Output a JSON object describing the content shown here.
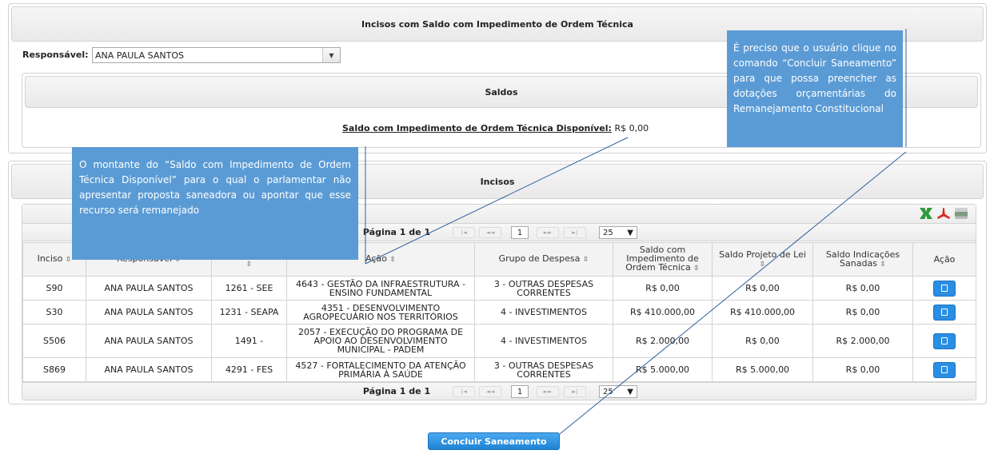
{
  "top_panel": {
    "title": "Incisos com Saldo com Impedimento de Ordem Técnica",
    "responsavel_label": "Responsável:",
    "responsavel_value": "ANA PAULA SANTOS"
  },
  "saldos": {
    "title": "Saldos",
    "label": "Saldo com Impedimento de Ordem Técnica Disponível:",
    "value": "R$ 0,00"
  },
  "incisos": {
    "title": "Incisos",
    "pager_text": "Página 1 de 1",
    "page_number": "1",
    "page_size": "25",
    "columns": [
      "Inciso",
      "Responsável",
      "",
      "Ação",
      "Grupo de Despesa",
      "Saldo com Impedimento de Ordem Técnica",
      "Saldo Projeto de Lei",
      "Saldo Indicações Sanadas",
      "Ação"
    ],
    "rows": [
      {
        "inciso": "S90",
        "responsavel": "ANA PAULA SANTOS",
        "orgao": "1261 - SEE",
        "acao": "4643 - GESTÃO DA INFRAESTRUTURA - ENSINO FUNDAMENTAL",
        "grupo": "3 - OUTRAS DESPESAS CORRENTES",
        "saldo_impedimento": "R$ 0,00",
        "saldo_projeto": "R$ 0,00",
        "saldo_sanadas": "R$ 0,00"
      },
      {
        "inciso": "S30",
        "responsavel": "ANA PAULA SANTOS",
        "orgao": "1231 - SEAPA",
        "acao": "4351 - DESENVOLVIMENTO AGROPECUÁRIO NOS TERRITÓRIOS",
        "grupo": "4 - INVESTIMENTOS",
        "saldo_impedimento": "R$ 410.000,00",
        "saldo_projeto": "R$ 410.000,00",
        "saldo_sanadas": "R$ 0,00"
      },
      {
        "inciso": "S506",
        "responsavel": "ANA PAULA SANTOS",
        "orgao": "1491 -",
        "acao": "2057 - EXECUÇÃO DO PROGRAMA DE APOIO AO DESENVOLVIMENTO MUNICIPAL - PADEM",
        "grupo": "4 - INVESTIMENTOS",
        "saldo_impedimento": "R$ 2.000,00",
        "saldo_projeto": "R$ 0,00",
        "saldo_sanadas": "R$ 2.000,00"
      },
      {
        "inciso": "S869",
        "responsavel": "ANA PAULA SANTOS",
        "orgao": "4291 - FES",
        "acao": "4527 - FORTALECIMENTO DA ATENÇÃO PRIMÁRIA À SAÚDE",
        "grupo": "3 - OUTRAS DESPESAS CORRENTES",
        "saldo_impedimento": "R$ 5.000,00",
        "saldo_projeto": "R$ 5.000,00",
        "saldo_sanadas": "R$ 0,00"
      }
    ]
  },
  "concluir_button": "Concluir Saneamento",
  "callouts": {
    "left": "O montante do “Saldo com Impedimento de Ordem Técnica Disponível” para o qual o parlamentar não apresentar proposta saneadora ou apontar que esse recurso será remanejado",
    "right": "É preciso que o usuário clique no comando “Concluir Saneamento” para que possa preencher as dotações orçamentárias do Remanejamento Constitucional"
  },
  "colors": {
    "callout": "#5b9bd5",
    "button": "#1d83d6",
    "line": "#2f5f9e"
  },
  "icons": [
    "excel-export-icon",
    "pdf-export-icon",
    "print-icon",
    "sort-icon",
    "edit-document-icon"
  ]
}
